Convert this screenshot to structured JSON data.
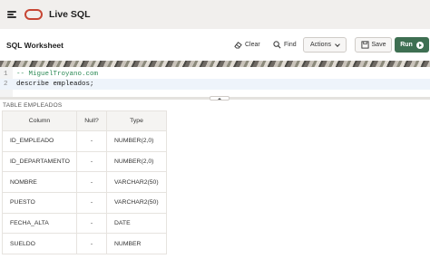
{
  "header": {
    "app_title": "Live SQL",
    "menu_icon": "hamburger-menu-icon",
    "logo": "oracle-logo",
    "brand_color": "#c74634"
  },
  "toolbar": {
    "worksheet_title": "SQL Worksheet",
    "clear_label": "Clear",
    "find_label": "Find",
    "actions_label": "Actions",
    "save_label": "Save",
    "run_label": "Run",
    "run_color": "#3e6f52"
  },
  "editor": {
    "lines": [
      {
        "number": "1",
        "text": "-- MiguelTroyano.com",
        "kind": "comment"
      },
      {
        "number": "2",
        "text": "describe empleados;",
        "kind": "statement"
      }
    ]
  },
  "results": {
    "caption": "TABLE EMPLEADOS",
    "columns": [
      "Column",
      "Null?",
      "Type"
    ],
    "rows": [
      [
        "ID_EMPLEADO",
        "-",
        "NUMBER(2,0)"
      ],
      [
        "ID_DEPARTAMENTO",
        "-",
        "NUMBER(2,0)"
      ],
      [
        "NOMBRE",
        "-",
        "VARCHAR2(50)"
      ],
      [
        "PUESTO",
        "-",
        "VARCHAR2(50)"
      ],
      [
        "FECHA_ALTA",
        "-",
        "DATE"
      ],
      [
        "SUELDO",
        "-",
        "NUMBER"
      ]
    ]
  }
}
